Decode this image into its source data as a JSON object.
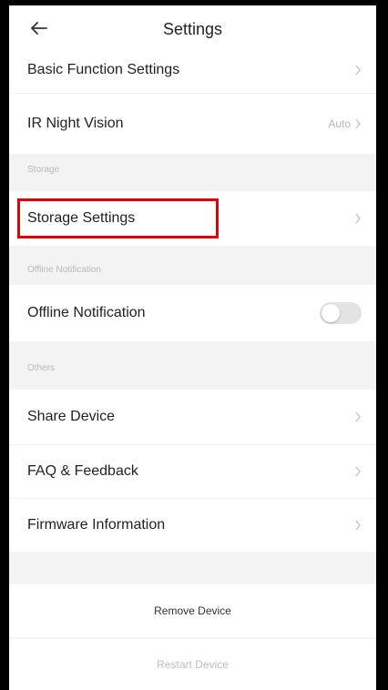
{
  "header": {
    "title": "Settings",
    "back_icon": "arrow-left-icon"
  },
  "rows": {
    "basic_function": {
      "label": "Basic Function Settings"
    },
    "ir_night_vision": {
      "label": "IR Night Vision",
      "value": "Auto"
    },
    "storage_settings": {
      "label": "Storage Settings"
    },
    "offline_notification": {
      "label": "Offline Notification",
      "toggle_on": false
    },
    "share_device": {
      "label": "Share Device"
    },
    "faq_feedback": {
      "label": "FAQ & Feedback"
    },
    "firmware_info": {
      "label": "Firmware Information"
    }
  },
  "sections": {
    "storage": "Storage",
    "offline_notification": "Offline Notification",
    "others": "Others"
  },
  "actions": {
    "remove_device": "Remove Device",
    "restart_device": "Restart Device"
  },
  "colors": {
    "highlight": "#e30000",
    "background": "#f3f3f4",
    "chevron": "#b5b5b5"
  }
}
